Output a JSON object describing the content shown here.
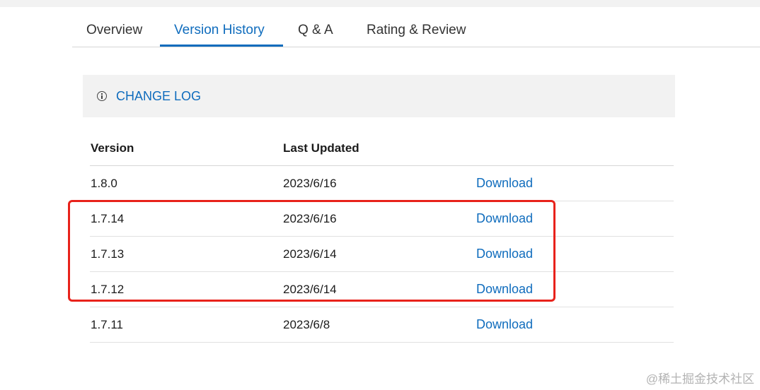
{
  "tabs": [
    {
      "label": "Overview"
    },
    {
      "label": "Version History"
    },
    {
      "label": "Q & A"
    },
    {
      "label": "Rating & Review"
    }
  ],
  "changelog": {
    "label": "CHANGE LOG",
    "icon": "info-icon"
  },
  "table": {
    "headers": {
      "version": "Version",
      "updated": "Last Updated"
    },
    "rows": [
      {
        "version": "1.8.0",
        "updated": "2023/6/16",
        "action": "Download"
      },
      {
        "version": "1.7.14",
        "updated": "2023/6/16",
        "action": "Download"
      },
      {
        "version": "1.7.13",
        "updated": "2023/6/14",
        "action": "Download"
      },
      {
        "version": "1.7.12",
        "updated": "2023/6/14",
        "action": "Download"
      },
      {
        "version": "1.7.11",
        "updated": "2023/6/8",
        "action": "Download"
      }
    ]
  },
  "watermark": "@稀土掘金技术社区",
  "colors": {
    "accent": "#0f6cbd",
    "highlight": "#e8221b"
  }
}
